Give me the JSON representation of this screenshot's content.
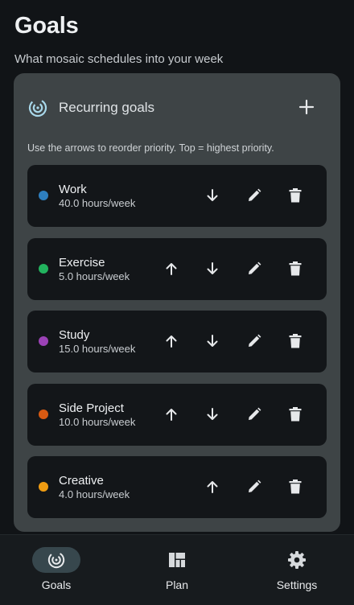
{
  "header": {
    "title": "Goals",
    "subtitle": "What mosaic schedules into your week"
  },
  "card": {
    "title": "Recurring goals",
    "icon": "target-icon",
    "add_icon": "plus-icon",
    "hint": "Use the arrows to reorder priority. Top = highest priority."
  },
  "goals": [
    {
      "name": "Work",
      "hours": "40.0 hours/week",
      "color": "#2e7fbf",
      "can_move_up": false,
      "can_move_down": true
    },
    {
      "name": "Exercise",
      "hours": "5.0 hours/week",
      "color": "#22b35e",
      "can_move_up": true,
      "can_move_down": true
    },
    {
      "name": "Study",
      "hours": "15.0 hours/week",
      "color": "#9b42b6",
      "can_move_up": true,
      "can_move_down": true
    },
    {
      "name": "Side Project",
      "hours": "10.0 hours/week",
      "color": "#d85a12",
      "can_move_up": true,
      "can_move_down": true
    },
    {
      "name": "Creative",
      "hours": "4.0 hours/week",
      "color": "#ef9c12",
      "can_move_up": true,
      "can_move_down": false
    }
  ],
  "nav": {
    "items": [
      {
        "label": "Goals",
        "icon": "target-icon",
        "active": true
      },
      {
        "label": "Plan",
        "icon": "dashboard-grid-icon",
        "active": false
      },
      {
        "label": "Settings",
        "icon": "gear-icon",
        "active": false
      }
    ]
  },
  "colors": {
    "background": "#111417",
    "card": "#3e4446",
    "row": "#131619",
    "accent_pill": "#37474d",
    "head_icon": "#a8d8ea"
  }
}
